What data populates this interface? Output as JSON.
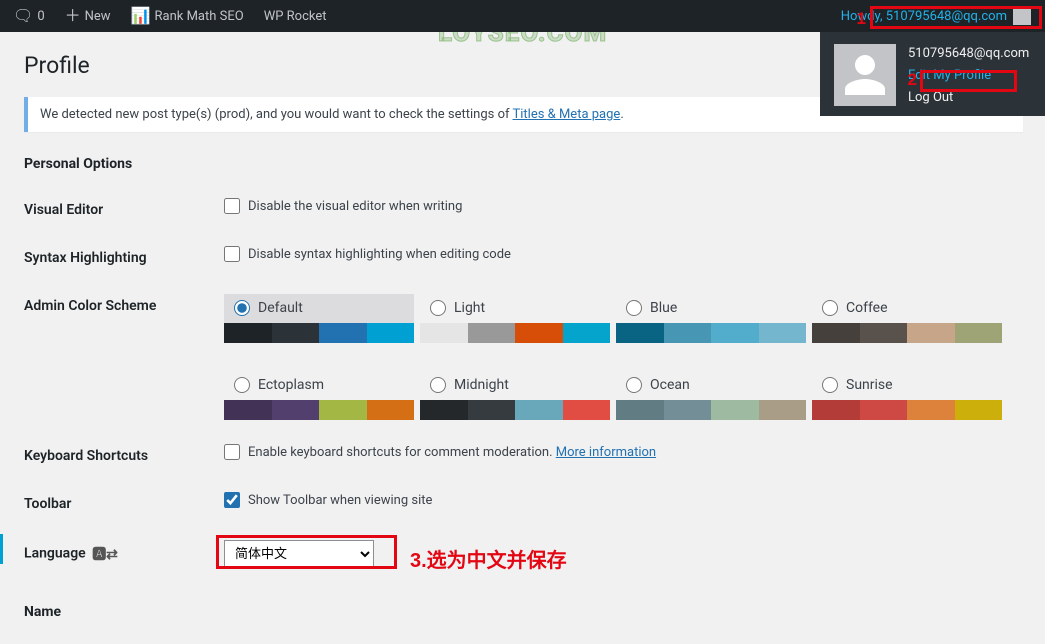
{
  "adminbar": {
    "comments_count": "0",
    "new_label": "New",
    "rankmath_label": "Rank Math SEO",
    "wprocket_label": "WP Rocket",
    "howdy_prefix": "Howdy, ",
    "user_display": "510795648@qq.com"
  },
  "user_menu": {
    "email": "510795648@qq.com",
    "edit_profile": "Edit My Profile",
    "logout": "Log Out"
  },
  "watermark": "LOYSEO.COM",
  "page": {
    "title": "Profile",
    "notice_prefix": "We detected new post type(s) (prod), and you would want to check the settings of ",
    "notice_link": "Titles & Meta page",
    "notice_suffix": "."
  },
  "sections": {
    "personal_options": "Personal Options",
    "name": "Name"
  },
  "fields": {
    "visual_editor": {
      "label": "Visual Editor",
      "checkbox": "Disable the visual editor when writing",
      "checked": false
    },
    "syntax_highlighting": {
      "label": "Syntax Highlighting",
      "checkbox": "Disable syntax highlighting when editing code",
      "checked": false
    },
    "admin_color": {
      "label": "Admin Color Scheme"
    },
    "keyboard_shortcuts": {
      "label": "Keyboard Shortcuts",
      "checkbox": "Enable keyboard shortcuts for comment moderation. ",
      "link": "More information",
      "checked": false
    },
    "toolbar": {
      "label": "Toolbar",
      "checkbox": "Show Toolbar when viewing site",
      "checked": true
    },
    "language": {
      "label": "Language ",
      "selected": "简体中文"
    }
  },
  "color_schemes": [
    {
      "name": "Default",
      "label": "Default",
      "selected": true,
      "colors": [
        "#1d2327",
        "#2c3338",
        "#2271b1",
        "#00a0d2"
      ]
    },
    {
      "name": "Light",
      "label": "Light",
      "selected": false,
      "colors": [
        "#e5e5e5",
        "#999999",
        "#d64e07",
        "#04a4cc"
      ]
    },
    {
      "name": "Blue",
      "label": "Blue",
      "selected": false,
      "colors": [
        "#096484",
        "#4796b3",
        "#52accc",
        "#74b6ce"
      ]
    },
    {
      "name": "Coffee",
      "label": "Coffee",
      "selected": false,
      "colors": [
        "#46403c",
        "#59524c",
        "#c7a589",
        "#9ea476"
      ]
    },
    {
      "name": "Ectoplasm",
      "label": "Ectoplasm",
      "selected": false,
      "colors": [
        "#413256",
        "#523f6d",
        "#a3b745",
        "#d46f15"
      ]
    },
    {
      "name": "Midnight",
      "label": "Midnight",
      "selected": false,
      "colors": [
        "#25282b",
        "#363b3f",
        "#69a8bb",
        "#e14d43"
      ]
    },
    {
      "name": "Ocean",
      "label": "Ocean",
      "selected": false,
      "colors": [
        "#627c83",
        "#738e96",
        "#9ebaa0",
        "#aa9d88"
      ]
    },
    {
      "name": "Sunrise",
      "label": "Sunrise",
      "selected": false,
      "colors": [
        "#b43c38",
        "#cf4944",
        "#dd823b",
        "#ccaf0b"
      ]
    }
  ],
  "annotations": {
    "n1": "1",
    "n2": "2",
    "n3": "3.选为中文并保存"
  }
}
